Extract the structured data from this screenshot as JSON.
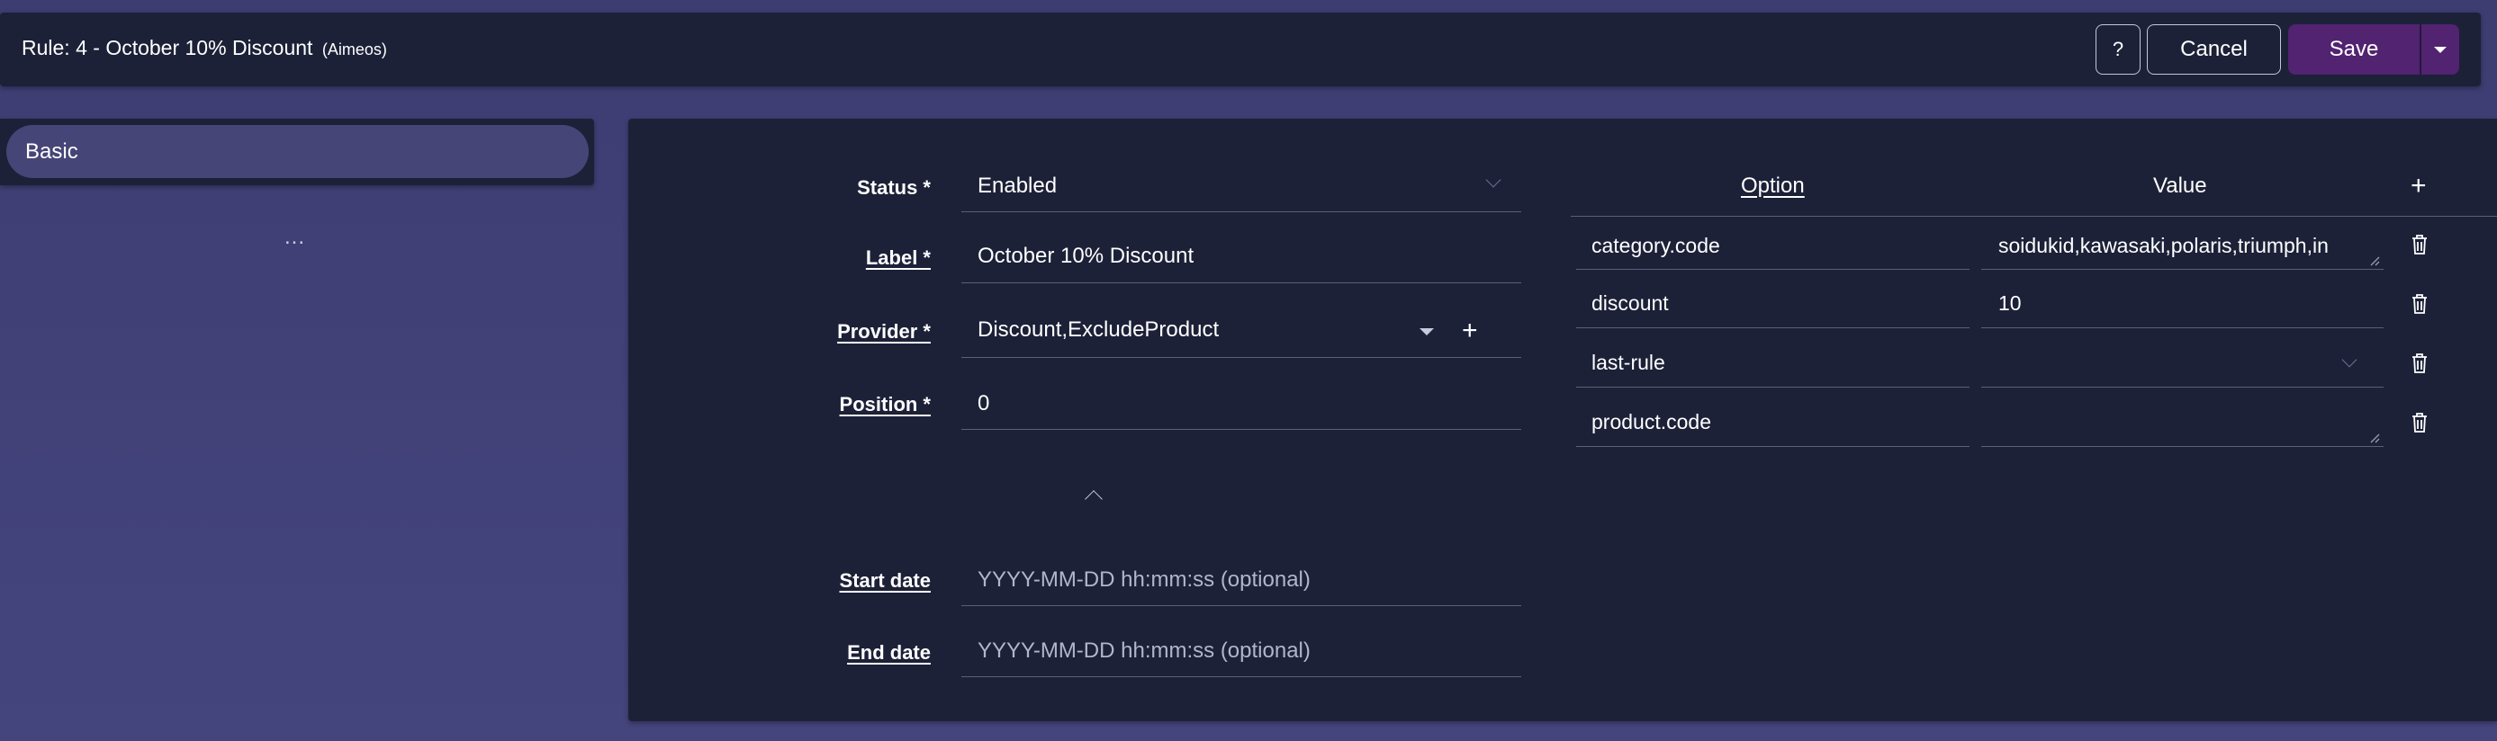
{
  "header": {
    "title": "Rule: 4 - October 10% Discount",
    "site": "(Aimeos)",
    "help_label": "?",
    "cancel_label": "Cancel",
    "save_label": "Save"
  },
  "nav": {
    "items": [
      {
        "label": "Basic"
      }
    ],
    "more": "..."
  },
  "form": {
    "status": {
      "label": "Status *",
      "value": "Enabled"
    },
    "label": {
      "label": "Label *",
      "value": "October 10% Discount"
    },
    "provider": {
      "label": "Provider *",
      "value": "Discount,ExcludeProduct"
    },
    "position": {
      "label": "Position *",
      "value": "0"
    },
    "start_date": {
      "label": "Start date",
      "placeholder": "YYYY-MM-DD hh:mm:ss (optional)"
    },
    "end_date": {
      "label": "End date",
      "placeholder": "YYYY-MM-DD hh:mm:ss (optional)"
    }
  },
  "config": {
    "headers": {
      "option": "Option",
      "value": "Value"
    },
    "rows": [
      {
        "option": "category.code",
        "value": "soidukid,kawasaki,polaris,triumph,in"
      },
      {
        "option": "discount",
        "value": "10"
      },
      {
        "option": "last-rule",
        "value": ""
      },
      {
        "option": "product.code",
        "value": ""
      }
    ]
  },
  "colors": {
    "background": "#3d3d72",
    "panel": "#1c2138",
    "accent": "#512370",
    "nav_active": "#454577"
  },
  "icons": [
    "chevron-down-icon",
    "plus-icon",
    "trash-icon",
    "caret-down-icon",
    "chevron-up-icon"
  ]
}
